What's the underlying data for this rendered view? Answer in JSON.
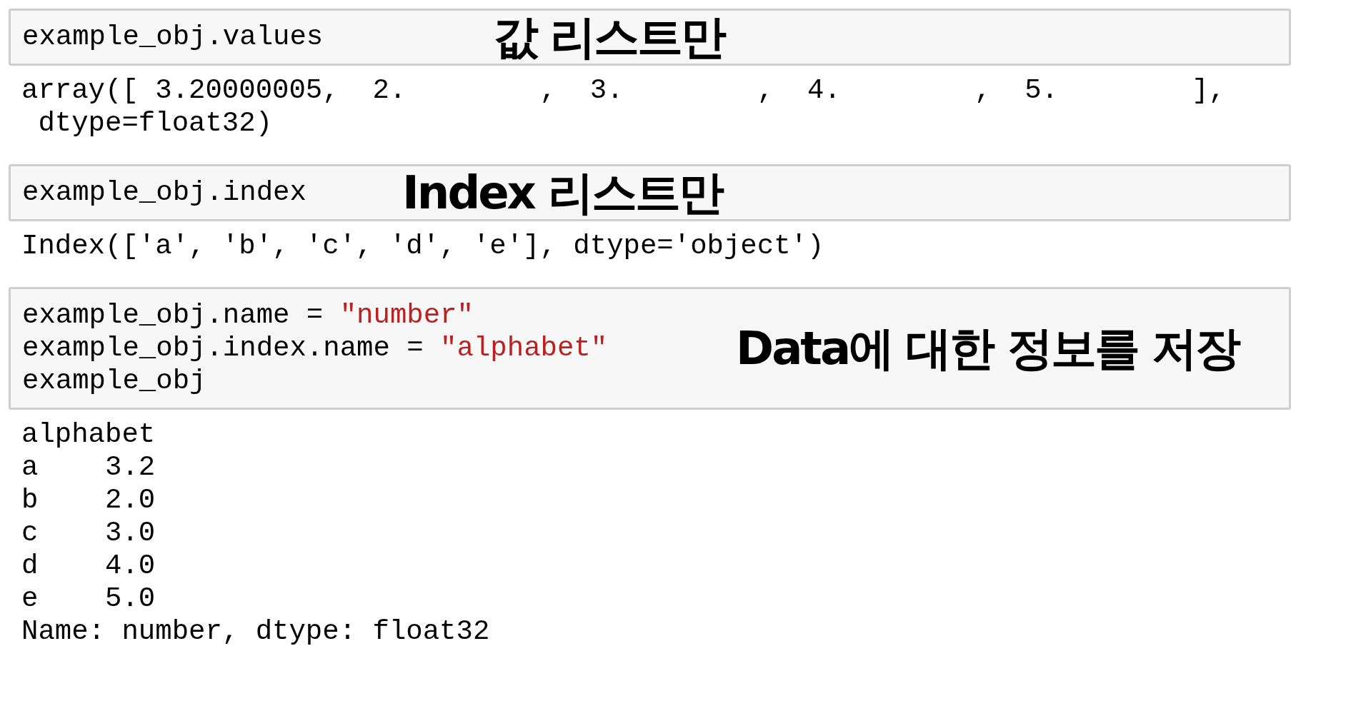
{
  "cells": [
    {
      "input": [
        [
          {
            "kind": "plain",
            "text": "example_obj.values"
          }
        ]
      ],
      "annotation": "값 리스트만",
      "output": [
        "array([ 3.20000005,  2.        ,  3.        ,  4.        ,  5.        ],",
        " dtype=float32)"
      ]
    },
    {
      "input": [
        [
          {
            "kind": "plain",
            "text": "example_obj.index"
          }
        ]
      ],
      "annotation": "Index 리스트만",
      "output": [
        "Index(['a', 'b', 'c', 'd', 'e'], dtype='object')"
      ]
    },
    {
      "input": [
        [
          {
            "kind": "plain",
            "text": "example_obj.name = "
          },
          {
            "kind": "string",
            "text": "\"number\""
          }
        ],
        [
          {
            "kind": "plain",
            "text": "example_obj.index.name = "
          },
          {
            "kind": "string",
            "text": "\"alphabet\""
          }
        ],
        [
          {
            "kind": "plain",
            "text": "example_obj"
          }
        ]
      ],
      "annotation": "Data에 대한 정보를 저장",
      "output": [
        "alphabet",
        "a    3.2",
        "b    2.0",
        "c    3.0",
        "d    4.0",
        "e    5.0",
        "Name: number, dtype: float32"
      ]
    }
  ]
}
